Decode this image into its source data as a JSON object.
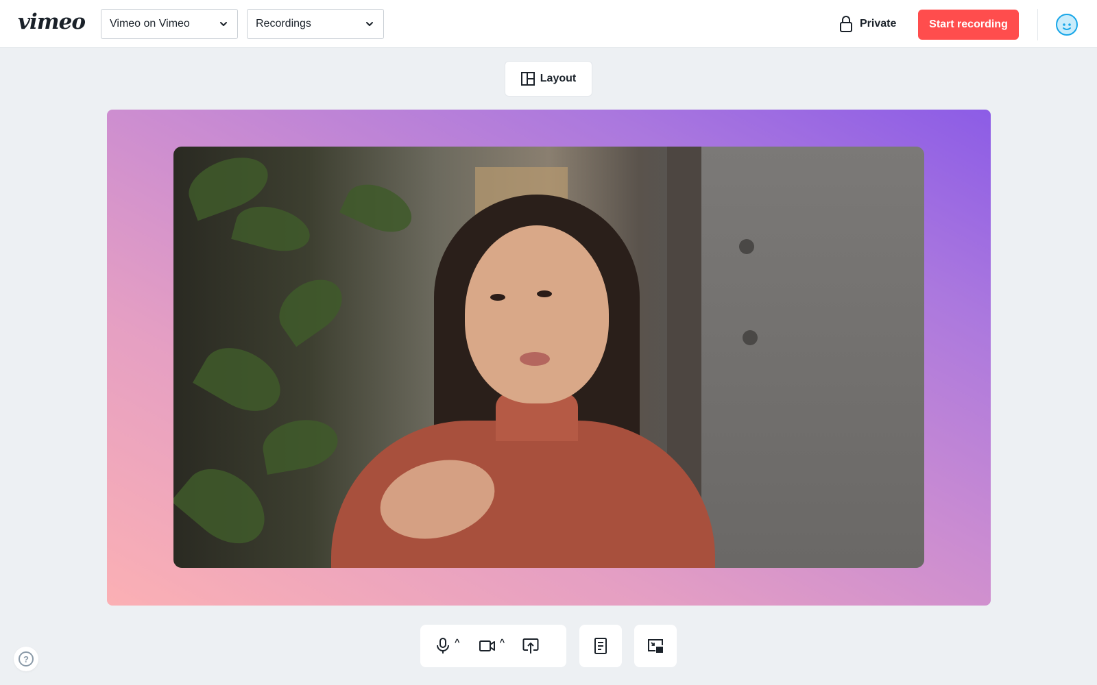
{
  "header": {
    "logo": "vimeo",
    "team_select": {
      "value": "Vimeo on Vimeo"
    },
    "folder_select": {
      "value": "Recordings"
    },
    "privacy": {
      "label": "Private",
      "icon": "lock-icon"
    },
    "start_recording_label": "Start recording",
    "avatar_icon": "smiley-avatar-icon"
  },
  "layout_button": {
    "label": "Layout",
    "icon": "layout-grid-icon"
  },
  "stage": {
    "background_gradient": {
      "from": "#fbb0b4",
      "to": "#8c5ce6"
    },
    "video_preview": "camera-feed"
  },
  "controls": {
    "microphone": {
      "icon": "microphone-icon",
      "has_options": true
    },
    "camera": {
      "icon": "video-camera-icon",
      "has_options": true
    },
    "share_screen": {
      "icon": "screen-share-icon"
    },
    "notes": {
      "icon": "notes-document-icon"
    },
    "picture_in_picture": {
      "icon": "picture-in-picture-icon"
    },
    "caret_glyph": "^"
  },
  "help": {
    "icon": "help-question-icon",
    "glyph": "?"
  },
  "colors": {
    "accent_red": "#ff4d4d",
    "page_background": "#edf0f3",
    "text": "#1a2129"
  }
}
